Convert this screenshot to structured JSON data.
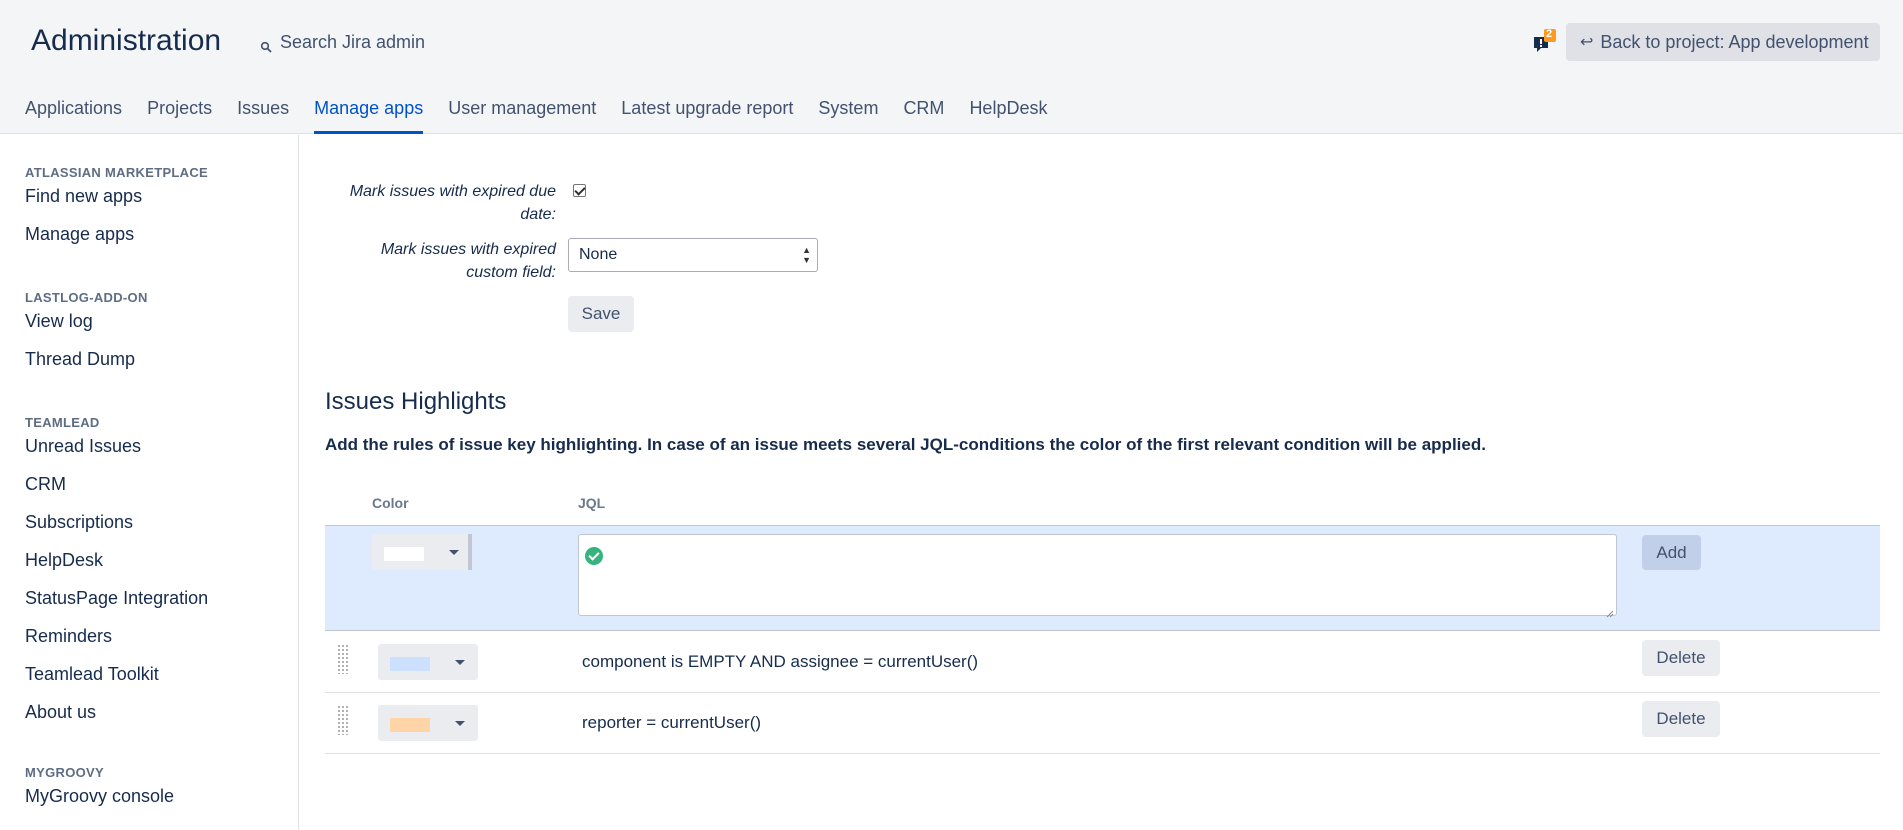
{
  "header": {
    "title": "Administration",
    "search_label": "Search Jira admin",
    "notification_count": "2",
    "back_button_label": "Back to project: App development"
  },
  "tabs": [
    {
      "label": "Applications"
    },
    {
      "label": "Projects"
    },
    {
      "label": "Issues"
    },
    {
      "label": "Manage apps",
      "active": true
    },
    {
      "label": "User management"
    },
    {
      "label": "Latest upgrade report"
    },
    {
      "label": "System"
    },
    {
      "label": "CRM"
    },
    {
      "label": "HelpDesk"
    }
  ],
  "sidebar": {
    "groups": [
      {
        "heading": "ATLASSIAN MARKETPLACE",
        "items": [
          "Find new apps",
          "Manage apps"
        ]
      },
      {
        "heading": "LASTLOG-ADD-ON",
        "items": [
          "View log",
          "Thread Dump"
        ]
      },
      {
        "heading": "TEAMLEAD",
        "items": [
          "Unread Issues",
          "CRM",
          "Subscriptions",
          "HelpDesk",
          "StatusPage Integration",
          "Reminders",
          "Teamlead Toolkit",
          "About us"
        ]
      },
      {
        "heading": "MYGROOVY",
        "items": [
          "MyGroovy console"
        ]
      }
    ]
  },
  "settings": {
    "expired_due_date_label_line1": "Mark issues with expired due",
    "expired_due_date_label_line2": "date:",
    "expired_due_date_checked": true,
    "expired_custom_field_label_line1": "Mark issues with expired",
    "expired_custom_field_label_line2": "custom field:",
    "expired_custom_field_value": "None",
    "save_label": "Save"
  },
  "highlights": {
    "title": "Issues Highlights",
    "description": "Add the rules of issue key highlighting. In case of an issue meets several JQL-conditions the color of the first relevant condition will be applied.",
    "col_color": "Color",
    "col_jql": "JQL",
    "new_row": {
      "color": "#ffffff",
      "jql": "",
      "add_label": "Add"
    },
    "rules": [
      {
        "color": "#cce0ff",
        "jql": "component is EMPTY AND assignee = currentUser()",
        "delete_label": "Delete"
      },
      {
        "color": "#ffd5a8",
        "jql": "reporter = currentUser()",
        "delete_label": "Delete"
      }
    ]
  },
  "colors": {
    "accent": "#0052cc",
    "success": "#36b37e",
    "notification_badge": "#ff991f"
  }
}
